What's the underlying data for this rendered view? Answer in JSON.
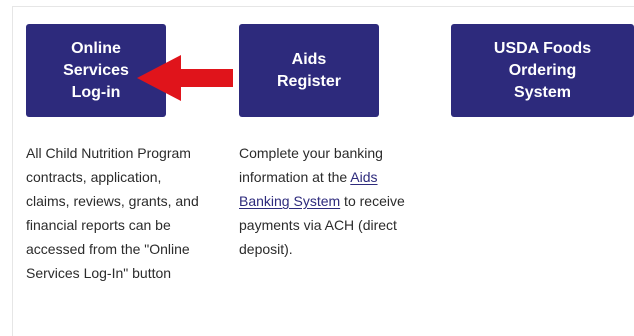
{
  "tiles": {
    "online_services": "Online\nServices\nLog-in",
    "aids_register": "Aids\nRegister",
    "usda_foods": "USDA Foods\nOrdering\nSystem"
  },
  "descriptions": {
    "online_services_lines": [
      "All Child Nutrition Program",
      "contracts, application,",
      "claims, reviews, grants, and",
      "financial reports can be",
      "accessed from the \"Online",
      "Services Log-In\" button"
    ],
    "aids_line1": "Complete your banking",
    "aids_line2_pre": "information at the ",
    "aids_link_part1": "Aids",
    "aids_link_part2": "Banking System",
    "aids_line3_post": " to receive",
    "aids_line4": "payments via ACH (direct",
    "aids_line5": "deposit)."
  },
  "colors": {
    "tile_bg": "#2d2a7c",
    "arrow": "#e0141b"
  },
  "icons": {
    "pointer": "red-arrow-icon"
  }
}
